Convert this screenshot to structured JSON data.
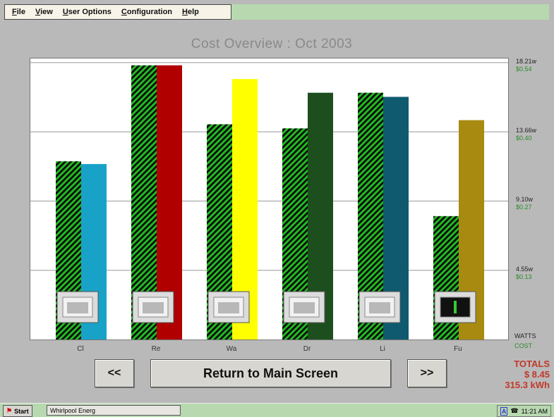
{
  "menu": {
    "items": [
      "File",
      "View",
      "User Options",
      "Configuration",
      "Help"
    ]
  },
  "chart_data": {
    "type": "bar",
    "title": "Cost Overview : Oct 2003",
    "categories": [
      "Cl",
      "Re",
      "Wa",
      "Dr",
      "Li",
      "Fu"
    ],
    "series": [
      {
        "values": [
          13.0,
          20.0,
          15.7,
          15.4,
          18.0,
          9.0
        ],
        "color": "#19a319"
      },
      {
        "values": [
          12.8,
          20.0,
          19.0,
          18.0,
          17.7,
          16.0
        ],
        "colors": [
          "#18a2c8",
          "#b00000",
          "#ffff00",
          "#1d4e1d",
          "#0f5a6e",
          "#a88a10"
        ]
      }
    ],
    "icons": [
      "oven-icon",
      "microwave-icon",
      "washer-icon",
      "dryer-icon",
      "lights-icon",
      "furnace-icon"
    ],
    "yticks": [
      {
        "value": 20.2,
        "watts": "18.21w",
        "cost": "$0.54"
      },
      {
        "value": 15.15,
        "watts": "13.66w",
        "cost": "$0.40"
      },
      {
        "value": 10.1,
        "watts": "9.10w",
        "cost": "$0.27"
      },
      {
        "value": 5.05,
        "watts": "4.55w",
        "cost": "$0.13"
      }
    ],
    "ylim": [
      0,
      20.5
    ],
    "grid": true,
    "y_unit_watts": "WATTS",
    "y_unit_cost": "COST"
  },
  "nav": {
    "prev_label": "<<",
    "main_label": "Return to Main Screen",
    "next_label": ">>"
  },
  "totals": {
    "label": "TOTALS",
    "cost": "$ 8.45",
    "kwh": "315.3 kWh"
  },
  "taskbar": {
    "start_label": "Start",
    "task_label": "Whirlpool Energ",
    "time": "11:21 AM"
  }
}
